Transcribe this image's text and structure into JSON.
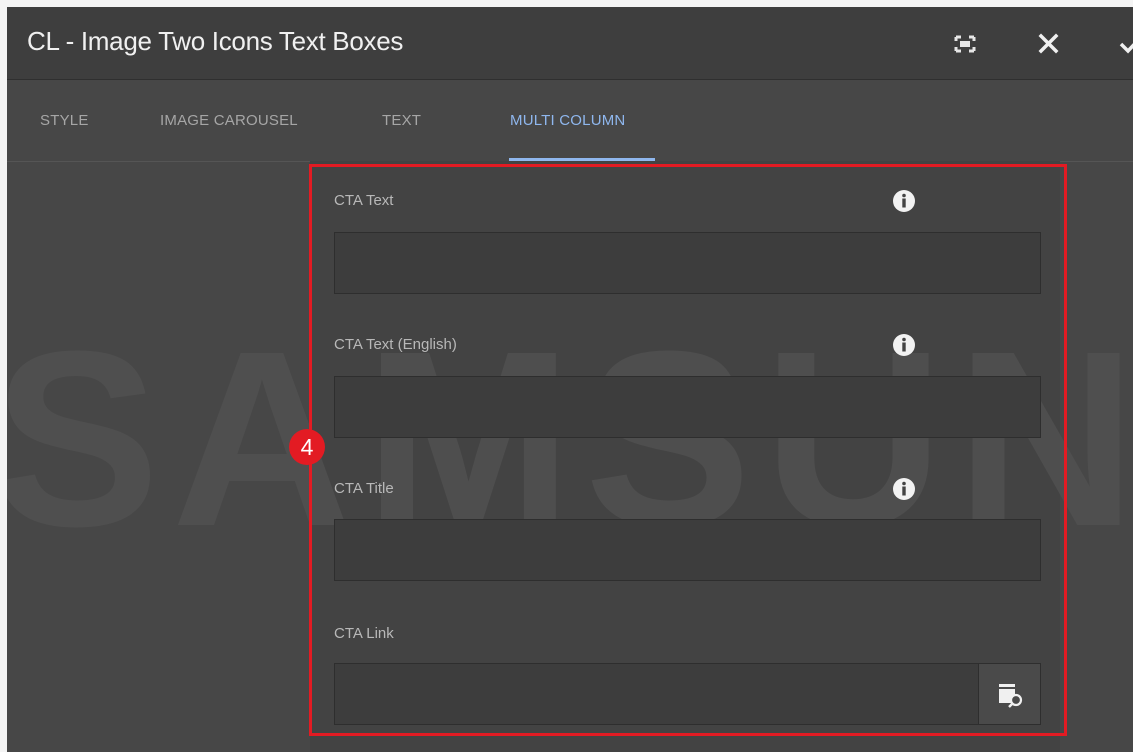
{
  "dialog": {
    "title": "CL - Image Two Icons Text Boxes",
    "controls": {
      "fullscreen": "fullscreen-icon",
      "close": "close-icon",
      "confirm": "check-icon"
    }
  },
  "tabs": [
    {
      "label": "STYLE",
      "active": false
    },
    {
      "label": "IMAGE CAROUSEL",
      "active": false
    },
    {
      "label": "TEXT",
      "active": false
    },
    {
      "label": "MULTI COLUMN",
      "active": true
    }
  ],
  "watermark": {
    "text": "SAMSUNG"
  },
  "form": {
    "fields": [
      {
        "label": "CTA Text",
        "value": "",
        "has_info": true
      },
      {
        "label": "CTA Text (English)",
        "value": "",
        "has_info": true
      },
      {
        "label": "CTA Title",
        "value": "",
        "has_info": true
      },
      {
        "label": "CTA Link",
        "value": "",
        "has_picker": true
      }
    ]
  },
  "annotation": {
    "marker": "4",
    "color": "#e31b23"
  },
  "colors": {
    "accent": "#8fb7ee",
    "background": "#474747",
    "highlight": "#e31b23"
  }
}
